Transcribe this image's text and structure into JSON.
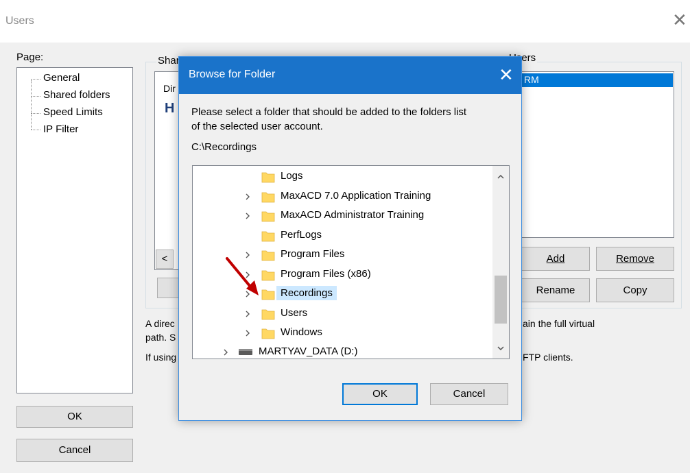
{
  "window": {
    "title": "Users"
  },
  "page": {
    "label": "Page:",
    "items": [
      "General",
      "Shared folders",
      "Speed Limits",
      "IP Filter"
    ]
  },
  "shared": {
    "group_label": "Shared folders",
    "col_partial": "Dir",
    "row_partial": "H",
    "scroll_left": "<",
    "text1_part": "A direc",
    "text1_tail": "ain the full virtual",
    "text2_part": "path. S",
    "text3_part": "If using",
    "text3_tail": "FTP clients."
  },
  "users": {
    "group_label": "Users",
    "selected_partial": "RM",
    "add_label": "Add",
    "remove_label": "Remove",
    "rename_label": "Rename",
    "copy_label": "Copy"
  },
  "buttons": {
    "ok": "OK",
    "cancel": "Cancel"
  },
  "dialog": {
    "title": "Browse for Folder",
    "close_glyph": "✕",
    "instruction_line1": "Please select a folder that should be added to the folders list",
    "instruction_line2": "of the selected user account.",
    "path": "C:\\Recordings",
    "tree": [
      {
        "label": "Logs",
        "expandable": false,
        "selected": false
      },
      {
        "label": "MaxACD 7.0 Application Training",
        "expandable": true,
        "selected": false
      },
      {
        "label": "MaxACD Administrator Training",
        "expandable": true,
        "selected": false
      },
      {
        "label": "PerfLogs",
        "expandable": false,
        "selected": false
      },
      {
        "label": "Program Files",
        "expandable": true,
        "selected": false
      },
      {
        "label": "Program Files (x86)",
        "expandable": true,
        "selected": false
      },
      {
        "label": "Recordings",
        "expandable": true,
        "selected": true
      },
      {
        "label": "Users",
        "expandable": true,
        "selected": false
      },
      {
        "label": "Windows",
        "expandable": true,
        "selected": false
      }
    ],
    "drive_label": "MARTYAV_DATA (D:)",
    "ok_label": "OK",
    "cancel_label": "Cancel"
  },
  "colors": {
    "dialog_title_bg": "#1a73ca",
    "selection": "#cce8ff",
    "folder": "#ffd863",
    "arrow": "#c00000",
    "users_selected": "#0078d7"
  },
  "icons": [
    "folder-icon",
    "chevron-right-icon",
    "drive-icon",
    "arrow-pointer-icon"
  ]
}
